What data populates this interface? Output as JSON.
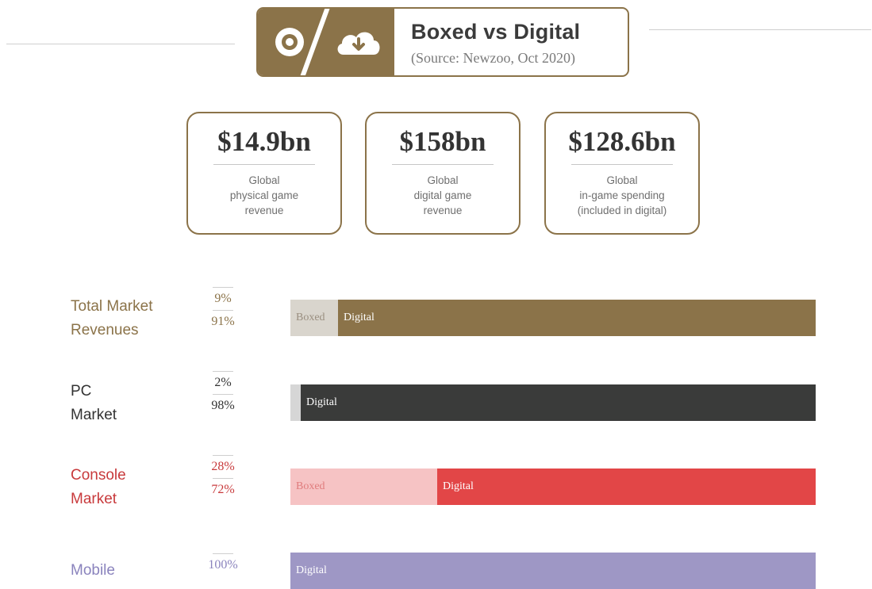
{
  "header": {
    "title": "Boxed vs Digital",
    "source": "(Source: Newzoo, Oct 2020)",
    "icons": [
      "disc-icon",
      "cloud-download-icon"
    ],
    "accent_color": "#8b7349"
  },
  "stats": [
    {
      "value": "$14.9bn",
      "description": "Global\nphysical game\nrevenue"
    },
    {
      "value": "$158bn",
      "description": "Global\ndigital game\nrevenue"
    },
    {
      "value": "$128.6bn",
      "description": "Global\nin-game spending\n(included in digital)"
    }
  ],
  "chart_data": {
    "type": "bar",
    "orientation": "horizontal",
    "stacked": true,
    "categories": [
      "Total Market Revenues",
      "PC Market",
      "Console Market",
      "Mobile"
    ],
    "label_lines": [
      [
        "Total Market",
        "Revenues"
      ],
      [
        "PC",
        "Market"
      ],
      [
        "Console",
        "Market"
      ],
      [
        "Mobile"
      ]
    ],
    "series": [
      {
        "name": "Boxed",
        "values": [
          9,
          2,
          28,
          0
        ],
        "labels": [
          "9%",
          "2%",
          "28%",
          ""
        ],
        "bar_labels": [
          "Boxed",
          "",
          "Boxed",
          ""
        ]
      },
      {
        "name": "Digital",
        "values": [
          91,
          98,
          72,
          100
        ],
        "labels": [
          "91%",
          "98%",
          "72%",
          "100%"
        ],
        "bar_labels": [
          "Digital",
          "Digital",
          "Digital",
          "Digital"
        ]
      }
    ],
    "colors": {
      "boxed": [
        "#d9d5cd",
        "#d6d6d6",
        "#f6c3c4",
        "#ffffff"
      ],
      "digital": [
        "#8b7349",
        "#3a3b3a",
        "#e24647",
        "#9e97c5"
      ],
      "label": [
        "#8b7349",
        "#333333",
        "#c83a3c",
        "#8a83bd"
      ],
      "boxed_text": [
        "#9a8f80",
        "#888888",
        "#e07c7d",
        "#ffffff"
      ]
    }
  }
}
